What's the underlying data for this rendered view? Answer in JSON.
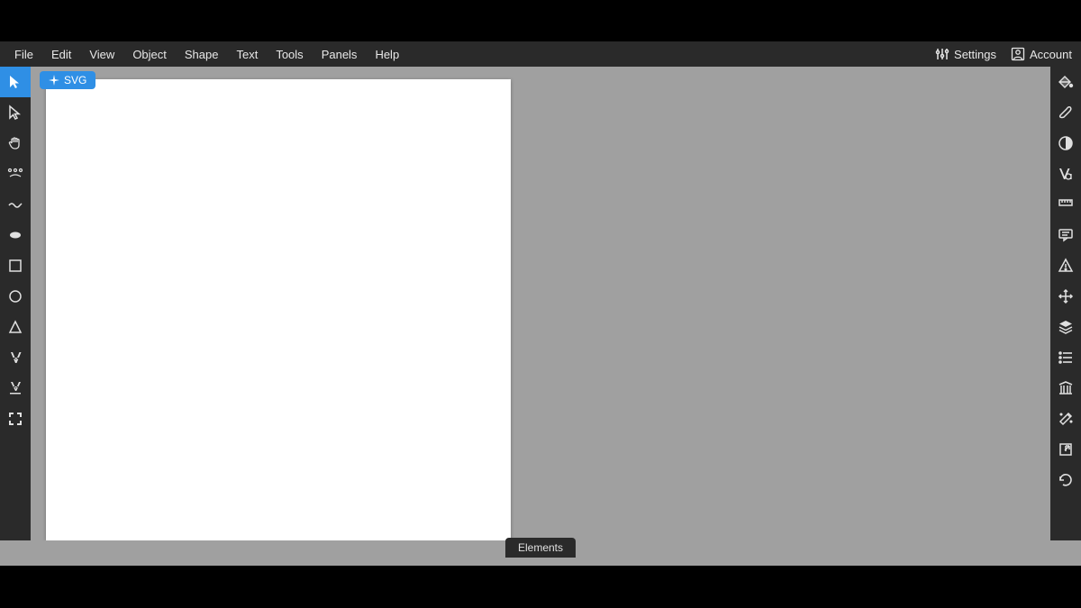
{
  "menubar": {
    "items": [
      "File",
      "Edit",
      "View",
      "Object",
      "Shape",
      "Text",
      "Tools",
      "Panels",
      "Help"
    ],
    "settings_label": "Settings",
    "account_label": "Account"
  },
  "canvas": {
    "tab_label": "SVG"
  },
  "bottom": {
    "elements_label": "Elements"
  },
  "left_tools": [
    {
      "name": "select-tool",
      "active": true
    },
    {
      "name": "direct-select-tool"
    },
    {
      "name": "pan-tool"
    },
    {
      "name": "nodes-tool"
    },
    {
      "name": "pencil-tool"
    },
    {
      "name": "brush-tool"
    },
    {
      "name": "rectangle-tool"
    },
    {
      "name": "ellipse-tool"
    },
    {
      "name": "triangle-tool"
    },
    {
      "name": "text-tool"
    },
    {
      "name": "text-path-tool"
    },
    {
      "name": "fullscreen-tool"
    }
  ],
  "right_panels": [
    {
      "name": "fill-panel"
    },
    {
      "name": "stroke-panel"
    },
    {
      "name": "contrast-panel"
    },
    {
      "name": "typography-panel"
    },
    {
      "name": "ruler-panel"
    },
    {
      "name": "comments-panel"
    },
    {
      "name": "warning-panel"
    },
    {
      "name": "move-panel"
    },
    {
      "name": "layers-panel"
    },
    {
      "name": "list-panel"
    },
    {
      "name": "library-panel"
    },
    {
      "name": "effects-panel"
    },
    {
      "name": "export-panel"
    },
    {
      "name": "undo-panel"
    }
  ]
}
